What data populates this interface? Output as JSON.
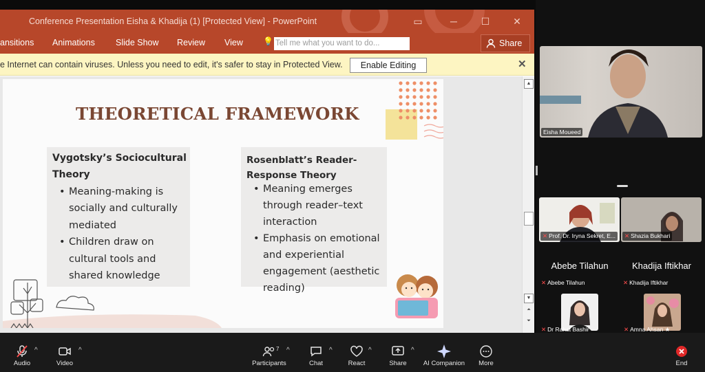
{
  "powerpoint": {
    "window_title": "Conference Presentation Eisha & Khadija (1) [Protected View] - PowerPoint",
    "ribbon_tabs": [
      "ansitions",
      "Animations",
      "Slide Show",
      "Review",
      "View"
    ],
    "tell_me_placeholder": "Tell me what you want to do...",
    "share_label": "Share",
    "protected_view_message": "e Internet can contain viruses. Unless you need to edit, it's safer to stay in Protected View.",
    "enable_editing_label": "Enable Editing",
    "close_glyph": "✕"
  },
  "slide": {
    "title": "THEORETICAL FRAMEWORK",
    "box1": {
      "heading": "Vygotsky’s Sociocultural Theory",
      "bullets": [
        "Meaning-making is socially and culturally mediated",
        "Children draw on cultural tools and shared knowledge"
      ]
    },
    "box2": {
      "heading": "Rosenblatt’s Reader-Response Theory",
      "bullets": [
        "Meaning emerges through reader–text interaction",
        "Emphasis on emotional and experiential engagement (aesthetic reading)"
      ]
    }
  },
  "participants": {
    "speaker": "Eisha Moueed",
    "tiles": [
      {
        "label": "Prof. Dr. Iryna Sekret, E..."
      },
      {
        "label": "Shazia Bukhari"
      },
      {
        "big": "Abebe Tilahun",
        "label": "Abebe Tilahun"
      },
      {
        "big": "Khadija Iftikhar",
        "label": "Khadija Iftikhar"
      },
      {
        "label": "Dr Rahat Bashir"
      },
      {
        "label": "Amna Ahsan ★"
      }
    ]
  },
  "toolbar": {
    "audio": "Audio",
    "video": "Video",
    "participants": "Participants",
    "participants_count": "7",
    "chat": "Chat",
    "react": "React",
    "share": "Share",
    "ai": "AI Companion",
    "more": "More",
    "end": "End"
  },
  "colors": {
    "ppt_accent": "#b7472a",
    "title_brown": "#7a4733",
    "end_red": "#e02828",
    "muted_red": "#ff4d4d"
  }
}
